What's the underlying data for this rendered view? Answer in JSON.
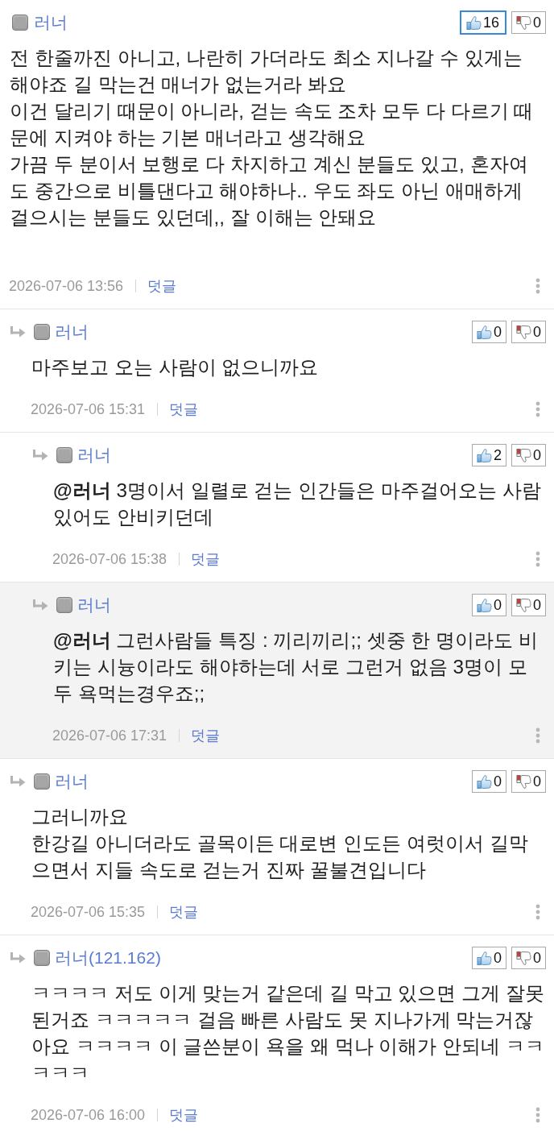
{
  "comments": [
    {
      "author": "러너",
      "votes": [
        {
          "kind": "up",
          "count": "16",
          "selected": true
        },
        {
          "kind": "down",
          "count": "0",
          "selected": false
        }
      ],
      "highlighted": false,
      "body": "전 한줄까진 아니고, 나란히 가더라도 최소 지나갈 수 있게는 해야죠 길 막는건 매너가 없는거라 봐요\n이건 달리기 때문이 아니라, 걷는 속도 조차 모두 다 다르기 때문에 지켜야 하는 기본 매너라고 생각해요\n가끔 두 분이서 보행로 다 차지하고 계신 분들도 있고, 혼자여도 중간으로 비틀댄다고 해야하나.. 우도 좌도 아닌 애매하게 걸으시는 분들도 있던데,, 잘 이해는 안돼요",
      "date": "2026-07-06 13:56",
      "reply_label": "덧글",
      "children": [
        {
          "author": "러너",
          "votes": [
            {
              "kind": "up",
              "count": "0",
              "selected": false
            },
            {
              "kind": "down",
              "count": "0",
              "selected": false
            }
          ],
          "highlighted": false,
          "body": "마주보고 오는 사람이 없으니까요",
          "date": "2026-07-06 15:31",
          "reply_label": "덧글",
          "children": [
            {
              "author": "러너",
              "votes": [
                {
                  "kind": "up",
                  "count": "2",
                  "selected": false
                },
                {
                  "kind": "down",
                  "count": "0",
                  "selected": false
                }
              ],
              "highlighted": false,
              "body": "**@러너** 3명이서 일렬로 걷는 인간들은 마주걸어오는 사람 있어도 안비키던데",
              "date": "2026-07-06 15:38",
              "reply_label": "덧글"
            },
            {
              "author": "러너",
              "votes": [
                {
                  "kind": "up",
                  "count": "0",
                  "selected": false
                },
                {
                  "kind": "down",
                  "count": "0",
                  "selected": false
                }
              ],
              "highlighted": true,
              "body": "**@러너** 그런사람들 특징 : 끼리끼리;; 셋중 한 명이라도 비키는 시늉이라도 해야하는데 서로 그런거 없음 3명이 모두 욕먹는경우죠;;",
              "date": "2026-07-06 17:31",
              "reply_label": "덧글"
            }
          ]
        },
        {
          "author": "러너",
          "votes": [
            {
              "kind": "up",
              "count": "0",
              "selected": false
            },
            {
              "kind": "down",
              "count": "0",
              "selected": false
            }
          ],
          "highlighted": false,
          "body": "그러니까요\n한강길 아니더라도 골목이든 대로변 인도든 여럿이서 길막으면서 지들 속도로 걷는거 진짜 꿀불견입니다",
          "date": "2026-07-06 15:35",
          "reply_label": "덧글"
        },
        {
          "author": "러너(121.162)",
          "votes": [
            {
              "kind": "up",
              "count": "0",
              "selected": false
            },
            {
              "kind": "down",
              "count": "0",
              "selected": false
            }
          ],
          "highlighted": false,
          "body": "ㅋㅋㅋㅋ 저도 이게 맞는거 같은데 길 막고 있으면 그게 잘못된거죠 ㅋㅋㅋㅋㅋ 걸음 빠른 사람도 못 지나가게 막는거잖아요 ㅋㅋㅋㅋ 이 글쓴분이 욕을 왜 먹나 이해가 안되네 ㅋㅋㅋㅋㅋ",
          "date": "2026-07-06 16:00",
          "reply_label": "덧글"
        }
      ]
    }
  ]
}
